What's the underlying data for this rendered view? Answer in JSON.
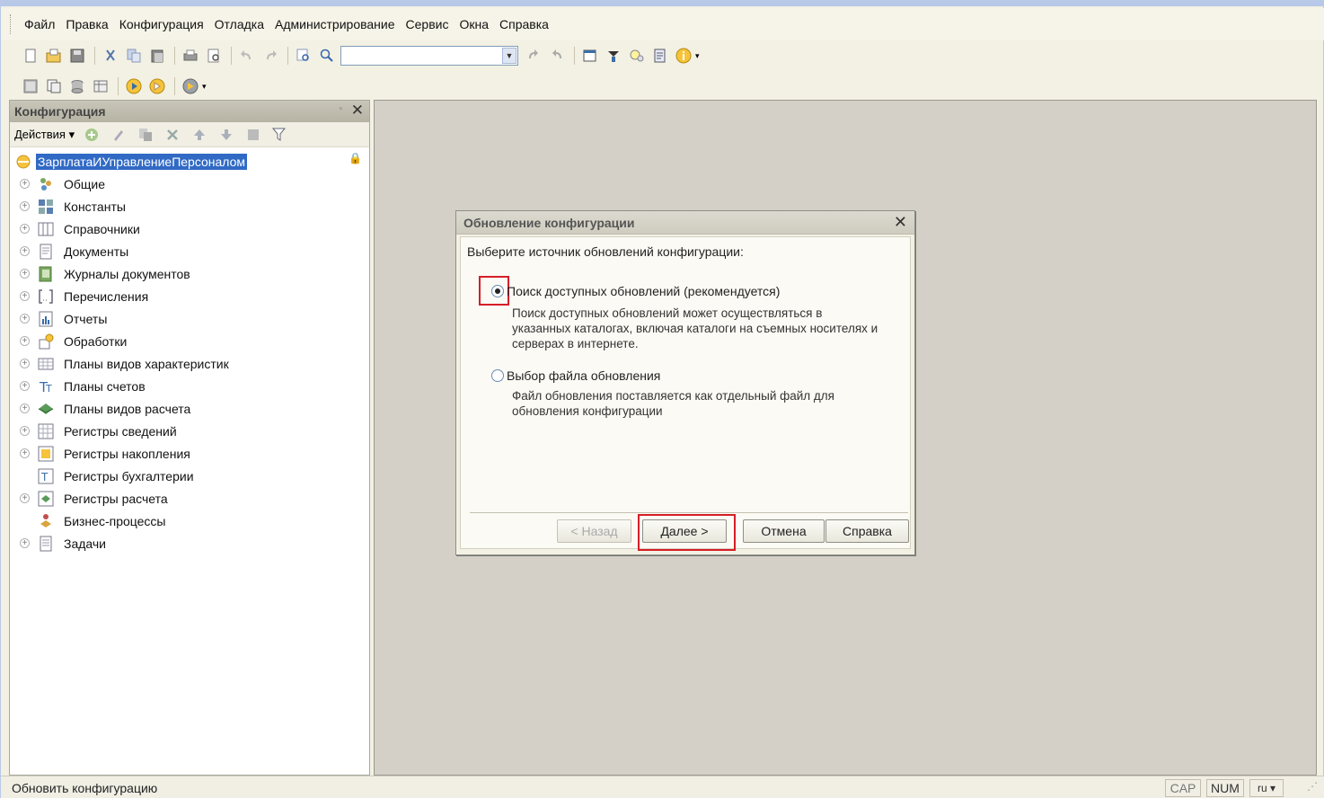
{
  "menu": {
    "items": [
      "Файл",
      "Правка",
      "Конфигурация",
      "Отладка",
      "Администрирование",
      "Сервис",
      "Окна",
      "Справка"
    ]
  },
  "colors": {
    "selection": "#316ac5",
    "highlight_red": "#d61e27",
    "workspace": "#d4d0c8"
  },
  "panel": {
    "title": "Конфигурация",
    "actions_label": "Действия ▾",
    "root": "ЗарплатаИУправлениеПерсоналом",
    "items": [
      {
        "label": "Общие",
        "icon": "common-icon",
        "expandable": true
      },
      {
        "label": "Константы",
        "icon": "constants-icon",
        "expandable": true
      },
      {
        "label": "Справочники",
        "icon": "catalogs-icon",
        "expandable": true
      },
      {
        "label": "Документы",
        "icon": "documents-icon",
        "expandable": true
      },
      {
        "label": "Журналы документов",
        "icon": "journals-icon",
        "expandable": true
      },
      {
        "label": "Перечисления",
        "icon": "enums-icon",
        "expandable": true
      },
      {
        "label": "Отчеты",
        "icon": "reports-icon",
        "expandable": true
      },
      {
        "label": "Обработки",
        "icon": "dataprocessors-icon",
        "expandable": true
      },
      {
        "label": "Планы видов характеристик",
        "icon": "chart-char-types-icon",
        "expandable": true
      },
      {
        "label": "Планы счетов",
        "icon": "chart-accounts-icon",
        "expandable": true
      },
      {
        "label": "Планы видов расчета",
        "icon": "chart-calc-types-icon",
        "expandable": true
      },
      {
        "label": "Регистры сведений",
        "icon": "info-registers-icon",
        "expandable": true
      },
      {
        "label": "Регистры накопления",
        "icon": "accum-registers-icon",
        "expandable": true
      },
      {
        "label": "Регистры бухгалтерии",
        "icon": "accounting-registers-icon",
        "expandable": false
      },
      {
        "label": "Регистры расчета",
        "icon": "calc-registers-icon",
        "expandable": true
      },
      {
        "label": "Бизнес-процессы",
        "icon": "business-processes-icon",
        "expandable": false
      },
      {
        "label": "Задачи",
        "icon": "tasks-icon",
        "expandable": true
      }
    ]
  },
  "dialog": {
    "title": "Обновление конфигурации",
    "prompt": "Выберите источник обновлений конфигурации:",
    "option1": {
      "label": "Поиск доступных обновлений (рекомендуется)",
      "selected": true,
      "description_lines": [
        "Поиск доступных обновлений может осуществляться в",
        "указанных каталогах, включая каталоги на съемных носителях и",
        "серверах в интернете."
      ]
    },
    "option2": {
      "label": "Выбор файла обновления",
      "selected": false,
      "description_lines": [
        "Файл обновления поставляется как отдельный файл для",
        "обновления конфигурации"
      ]
    },
    "buttons": {
      "back": "< Назад",
      "next": "Далее >",
      "cancel": "Отмена",
      "help": "Справка"
    }
  },
  "status": {
    "text": "Обновить конфигурацию",
    "cap": "CAP",
    "num": "NUM",
    "lang": "ru ▾"
  }
}
